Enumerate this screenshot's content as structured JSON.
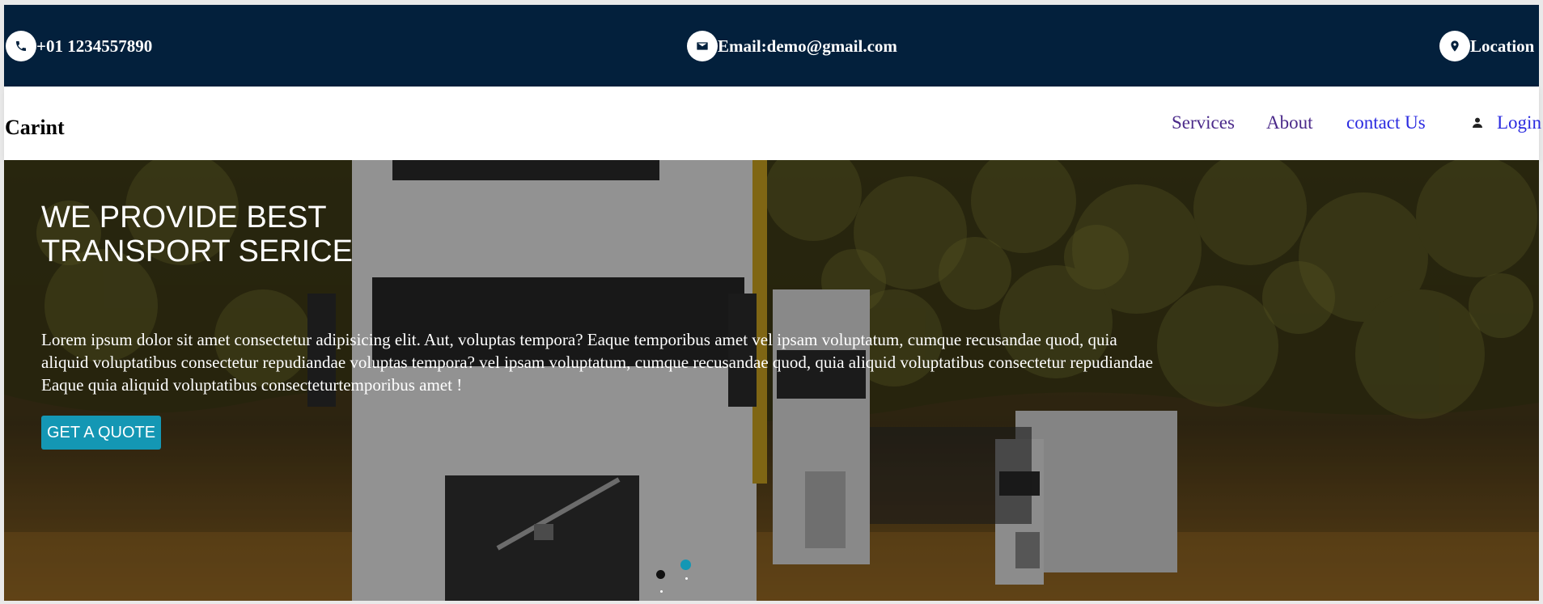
{
  "topbar": {
    "phone": "+01 1234557890",
    "email": "Email:demo@gmail.com",
    "location": "Location",
    "icons": [
      "phone-icon",
      "envelope-icon",
      "map-pin-icon"
    ],
    "background_color": "#03203c"
  },
  "navbar": {
    "brand": "Carint",
    "links": [
      "Services",
      "About",
      "contact Us"
    ],
    "login": "Login"
  },
  "hero": {
    "title": "WE PROVIDE BEST TRANSPORT SERICE",
    "text": "Lorem ipsum dolor sit amet consectetur adipisicing elit. Aut, voluptas tempora? Eaque temporibus amet vel ipsam voluptatum, cumque recusandae quod, quia aliquid voluptatibus consectetur repudiandae voluptas tempora? vel ipsam voluptatum, cumque recusandae quod, quia aliquid voluptatibus consectetur repudiandae Eaque quia aliquid voluptatibus consecteturtemporibus amet !",
    "button": "GET A QUOTE",
    "button_color": "#1497b4",
    "carousel_active_index": 2,
    "carousel_count": 2
  }
}
